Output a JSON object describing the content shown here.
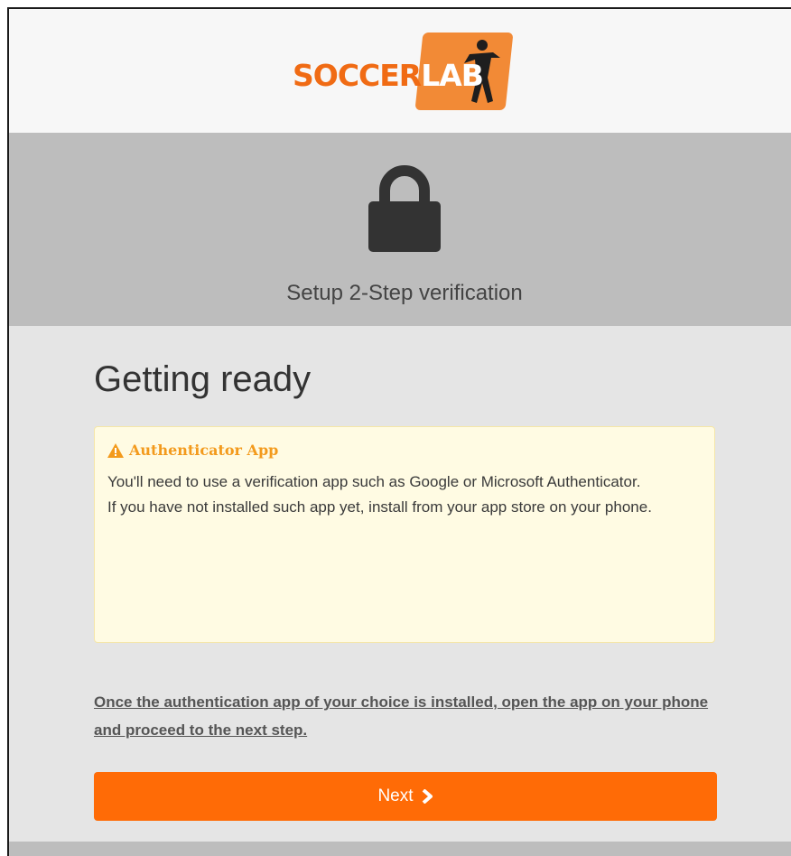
{
  "brand": {
    "logo_text_a": "SOCCER",
    "logo_text_b": "LAB",
    "logo_colors": {
      "orange": "#f06b14",
      "badge": "#f28a36"
    }
  },
  "header": {
    "icon": "lock-icon",
    "title": "Setup 2-Step verification"
  },
  "main": {
    "title": "Getting ready",
    "notice": {
      "icon": "warning-icon",
      "heading": "Authenticator App",
      "line1": "You'll need to use a verification app such as Google or Microsoft Authenticator.",
      "line2": "If you have not installed such app yet, install from your app store on your phone."
    },
    "instruction": "Once the authentication app of your choice is installed, open the app on your phone and proceed to the next step.",
    "next_button": {
      "label": "Next",
      "icon": "chevron-right-icon"
    }
  },
  "colors": {
    "accent": "#ff6b06",
    "header_band": "#bdbdbd",
    "notice_bg": "#fffbe3",
    "warning": "#f39a1c"
  }
}
